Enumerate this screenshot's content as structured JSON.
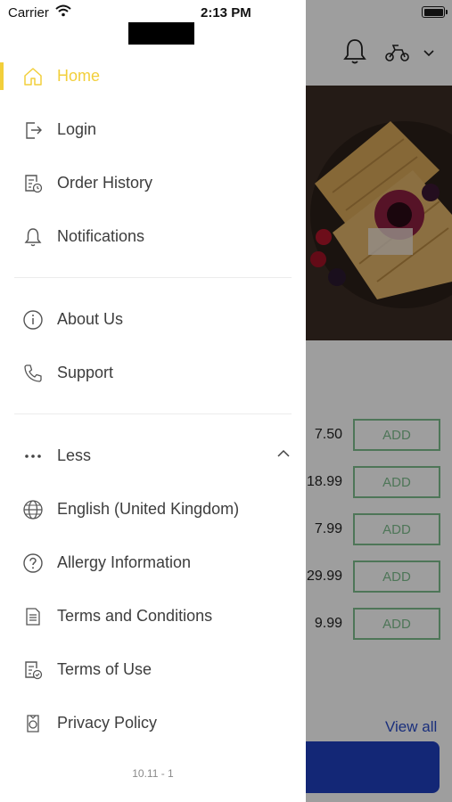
{
  "status_bar": {
    "carrier": "Carrier",
    "time": "2:13 PM"
  },
  "menu": {
    "primary": [
      {
        "label": "Home",
        "icon": "home-icon",
        "active": true
      },
      {
        "label": "Login",
        "icon": "login-icon"
      },
      {
        "label": "Order History",
        "icon": "order-history-icon"
      },
      {
        "label": "Notifications",
        "icon": "bell-icon"
      }
    ],
    "secondary": [
      {
        "label": "About Us",
        "icon": "info-icon"
      },
      {
        "label": "Support",
        "icon": "phone-icon"
      }
    ],
    "less_label": "Less",
    "more": [
      {
        "label": "English (United Kingdom)",
        "icon": "globe-icon"
      },
      {
        "label": "Allergy Information",
        "icon": "question-icon"
      },
      {
        "label": "Terms and Conditions",
        "icon": "document-icon"
      },
      {
        "label": "Terms of Use",
        "icon": "document-check-icon"
      },
      {
        "label": "Privacy Policy",
        "icon": "privacy-icon"
      }
    ]
  },
  "version": "10.11 - 1",
  "background": {
    "prices": [
      "7.50",
      "18.99",
      "7.99",
      "29.99",
      "9.99"
    ],
    "add_label": "ADD",
    "view_all": "View all"
  },
  "colors": {
    "accent": "#f2cf3b",
    "text": "#3d3d3d",
    "add_border": "#7fbf8f",
    "cta": "#1f3fbf"
  }
}
